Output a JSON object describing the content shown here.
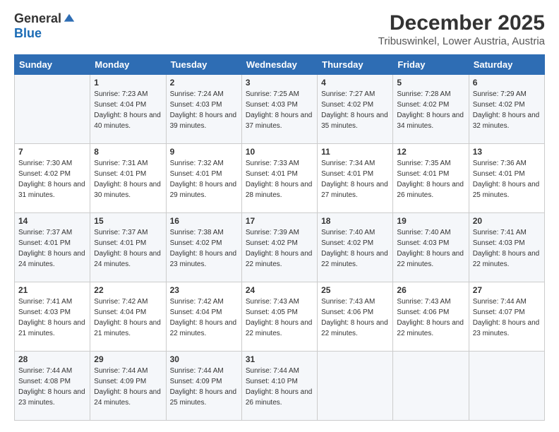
{
  "logo": {
    "general": "General",
    "blue": "Blue"
  },
  "title": "December 2025",
  "subtitle": "Tribuswinkel, Lower Austria, Austria",
  "days_header": [
    "Sunday",
    "Monday",
    "Tuesday",
    "Wednesday",
    "Thursday",
    "Friday",
    "Saturday"
  ],
  "weeks": [
    [
      {
        "day": "",
        "sunrise": "",
        "sunset": "",
        "daylight": ""
      },
      {
        "day": "1",
        "sunrise": "Sunrise: 7:23 AM",
        "sunset": "Sunset: 4:04 PM",
        "daylight": "Daylight: 8 hours and 40 minutes."
      },
      {
        "day": "2",
        "sunrise": "Sunrise: 7:24 AM",
        "sunset": "Sunset: 4:03 PM",
        "daylight": "Daylight: 8 hours and 39 minutes."
      },
      {
        "day": "3",
        "sunrise": "Sunrise: 7:25 AM",
        "sunset": "Sunset: 4:03 PM",
        "daylight": "Daylight: 8 hours and 37 minutes."
      },
      {
        "day": "4",
        "sunrise": "Sunrise: 7:27 AM",
        "sunset": "Sunset: 4:02 PM",
        "daylight": "Daylight: 8 hours and 35 minutes."
      },
      {
        "day": "5",
        "sunrise": "Sunrise: 7:28 AM",
        "sunset": "Sunset: 4:02 PM",
        "daylight": "Daylight: 8 hours and 34 minutes."
      },
      {
        "day": "6",
        "sunrise": "Sunrise: 7:29 AM",
        "sunset": "Sunset: 4:02 PM",
        "daylight": "Daylight: 8 hours and 32 minutes."
      }
    ],
    [
      {
        "day": "7",
        "sunrise": "Sunrise: 7:30 AM",
        "sunset": "Sunset: 4:02 PM",
        "daylight": "Daylight: 8 hours and 31 minutes."
      },
      {
        "day": "8",
        "sunrise": "Sunrise: 7:31 AM",
        "sunset": "Sunset: 4:01 PM",
        "daylight": "Daylight: 8 hours and 30 minutes."
      },
      {
        "day": "9",
        "sunrise": "Sunrise: 7:32 AM",
        "sunset": "Sunset: 4:01 PM",
        "daylight": "Daylight: 8 hours and 29 minutes."
      },
      {
        "day": "10",
        "sunrise": "Sunrise: 7:33 AM",
        "sunset": "Sunset: 4:01 PM",
        "daylight": "Daylight: 8 hours and 28 minutes."
      },
      {
        "day": "11",
        "sunrise": "Sunrise: 7:34 AM",
        "sunset": "Sunset: 4:01 PM",
        "daylight": "Daylight: 8 hours and 27 minutes."
      },
      {
        "day": "12",
        "sunrise": "Sunrise: 7:35 AM",
        "sunset": "Sunset: 4:01 PM",
        "daylight": "Daylight: 8 hours and 26 minutes."
      },
      {
        "day": "13",
        "sunrise": "Sunrise: 7:36 AM",
        "sunset": "Sunset: 4:01 PM",
        "daylight": "Daylight: 8 hours and 25 minutes."
      }
    ],
    [
      {
        "day": "14",
        "sunrise": "Sunrise: 7:37 AM",
        "sunset": "Sunset: 4:01 PM",
        "daylight": "Daylight: 8 hours and 24 minutes."
      },
      {
        "day": "15",
        "sunrise": "Sunrise: 7:37 AM",
        "sunset": "Sunset: 4:01 PM",
        "daylight": "Daylight: 8 hours and 24 minutes."
      },
      {
        "day": "16",
        "sunrise": "Sunrise: 7:38 AM",
        "sunset": "Sunset: 4:02 PM",
        "daylight": "Daylight: 8 hours and 23 minutes."
      },
      {
        "day": "17",
        "sunrise": "Sunrise: 7:39 AM",
        "sunset": "Sunset: 4:02 PM",
        "daylight": "Daylight: 8 hours and 22 minutes."
      },
      {
        "day": "18",
        "sunrise": "Sunrise: 7:40 AM",
        "sunset": "Sunset: 4:02 PM",
        "daylight": "Daylight: 8 hours and 22 minutes."
      },
      {
        "day": "19",
        "sunrise": "Sunrise: 7:40 AM",
        "sunset": "Sunset: 4:03 PM",
        "daylight": "Daylight: 8 hours and 22 minutes."
      },
      {
        "day": "20",
        "sunrise": "Sunrise: 7:41 AM",
        "sunset": "Sunset: 4:03 PM",
        "daylight": "Daylight: 8 hours and 22 minutes."
      }
    ],
    [
      {
        "day": "21",
        "sunrise": "Sunrise: 7:41 AM",
        "sunset": "Sunset: 4:03 PM",
        "daylight": "Daylight: 8 hours and 21 minutes."
      },
      {
        "day": "22",
        "sunrise": "Sunrise: 7:42 AM",
        "sunset": "Sunset: 4:04 PM",
        "daylight": "Daylight: 8 hours and 21 minutes."
      },
      {
        "day": "23",
        "sunrise": "Sunrise: 7:42 AM",
        "sunset": "Sunset: 4:04 PM",
        "daylight": "Daylight: 8 hours and 22 minutes."
      },
      {
        "day": "24",
        "sunrise": "Sunrise: 7:43 AM",
        "sunset": "Sunset: 4:05 PM",
        "daylight": "Daylight: 8 hours and 22 minutes."
      },
      {
        "day": "25",
        "sunrise": "Sunrise: 7:43 AM",
        "sunset": "Sunset: 4:06 PM",
        "daylight": "Daylight: 8 hours and 22 minutes."
      },
      {
        "day": "26",
        "sunrise": "Sunrise: 7:43 AM",
        "sunset": "Sunset: 4:06 PM",
        "daylight": "Daylight: 8 hours and 22 minutes."
      },
      {
        "day": "27",
        "sunrise": "Sunrise: 7:44 AM",
        "sunset": "Sunset: 4:07 PM",
        "daylight": "Daylight: 8 hours and 23 minutes."
      }
    ],
    [
      {
        "day": "28",
        "sunrise": "Sunrise: 7:44 AM",
        "sunset": "Sunset: 4:08 PM",
        "daylight": "Daylight: 8 hours and 23 minutes."
      },
      {
        "day": "29",
        "sunrise": "Sunrise: 7:44 AM",
        "sunset": "Sunset: 4:09 PM",
        "daylight": "Daylight: 8 hours and 24 minutes."
      },
      {
        "day": "30",
        "sunrise": "Sunrise: 7:44 AM",
        "sunset": "Sunset: 4:09 PM",
        "daylight": "Daylight: 8 hours and 25 minutes."
      },
      {
        "day": "31",
        "sunrise": "Sunrise: 7:44 AM",
        "sunset": "Sunset: 4:10 PM",
        "daylight": "Daylight: 8 hours and 26 minutes."
      },
      {
        "day": "",
        "sunrise": "",
        "sunset": "",
        "daylight": ""
      },
      {
        "day": "",
        "sunrise": "",
        "sunset": "",
        "daylight": ""
      },
      {
        "day": "",
        "sunrise": "",
        "sunset": "",
        "daylight": ""
      }
    ]
  ]
}
